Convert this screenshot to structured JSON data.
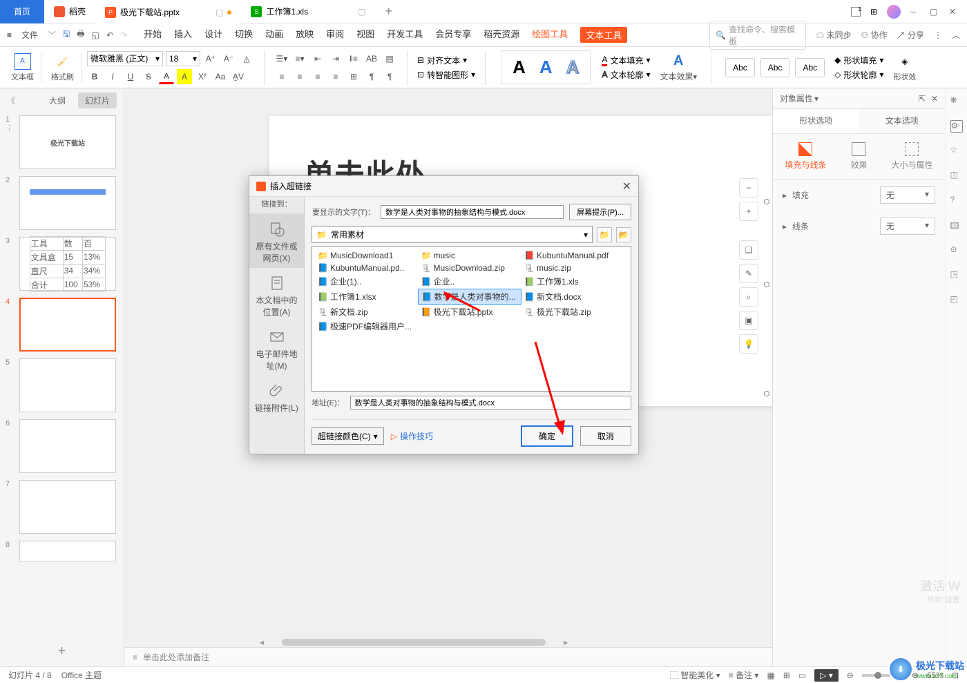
{
  "titlebar": {
    "home": "首页",
    "tab_daoke": "稻壳",
    "tab_pptx": "极光下载站.pptx",
    "tab_xls": "工作簿1.xls",
    "new_tab": "+"
  },
  "menubar": {
    "file": "文件",
    "tabs": [
      "开始",
      "插入",
      "设计",
      "切换",
      "动画",
      "放映",
      "审阅",
      "视图",
      "开发工具",
      "会员专享",
      "稻壳资源",
      "绘图工具",
      "文本工具"
    ],
    "search_placeholder": "查找命令、搜索模板",
    "unsync": "未同步",
    "coop": "协作",
    "share": "分享"
  },
  "ribbon": {
    "textbox": "文本框",
    "format_painter": "格式刷",
    "font_name": "微软雅黑 (正文)",
    "font_size": "18",
    "align_text": "对齐文本",
    "smart_graphic": "转智能图形",
    "text_fill": "文本填充",
    "text_outline": "文本轮廓",
    "text_effect": "文本效果",
    "abc": "Abc",
    "shape_fill": "形状填充",
    "shape_outline": "形状轮廓",
    "shape_effect": "形状效"
  },
  "outline": {
    "outline_tab": "大纲",
    "slides_tab": "幻灯片",
    "thumb1_text": "极光下载站"
  },
  "canvas": {
    "title_text": "单击此处",
    "notes_placeholder": "单击此处添加备注"
  },
  "props": {
    "header": "对象属性",
    "shape_options": "形状选项",
    "text_options": "文本选项",
    "fill_line": "填充与线条",
    "effect": "效果",
    "size_props": "大小与属性",
    "fill": "填充",
    "line": "线条",
    "none": "无"
  },
  "dialog": {
    "title": "插入超链接",
    "link_to": "链接到：",
    "display_text_label": "要显示的文字(T)：",
    "display_text_value": "数学是人类对事物的抽象结构与模式.docx",
    "screen_tip": "屏幕提示(P)...",
    "sidebar_existing": "原有文件或网页(X)",
    "sidebar_place": "本文档中的位置(A)",
    "sidebar_email": "电子邮件地址(M)",
    "sidebar_attach": "链接附件(L)",
    "folder": "常用素材",
    "address_label": "地址(E)：",
    "address_value": "数学是人类对事物的抽象结构与模式.docx",
    "link_color": "超链接颜色(C)",
    "tips": "操作技巧",
    "ok": "确定",
    "cancel": "取消",
    "files": [
      {
        "name": "MusicDownload1",
        "type": "folder"
      },
      {
        "name": "music",
        "type": "folder"
      },
      {
        "name": "KubuntuManual.pdf",
        "type": "pdf"
      },
      {
        "name": "KubuntuManual.pd..",
        "type": "doc"
      },
      {
        "name": "MusicDownload.zip",
        "type": "zip"
      },
      {
        "name": "music.zip",
        "type": "zip"
      },
      {
        "name": "企业(1)..",
        "type": "doc"
      },
      {
        "name": "企业..",
        "type": "doc"
      },
      {
        "name": "工作簿1.xls",
        "type": "xls"
      },
      {
        "name": "工作簿1.xlsx",
        "type": "xls"
      },
      {
        "name": "数学是人类对事物的...",
        "type": "doc",
        "selected": true
      },
      {
        "name": "新文档.docx",
        "type": "doc"
      },
      {
        "name": "新文档.zip",
        "type": "zip"
      },
      {
        "name": "极光下载站.pptx",
        "type": "ppt"
      },
      {
        "name": "极光下载站.zip",
        "type": "zip"
      },
      {
        "name": "极速PDF编辑器用户...",
        "type": "doc"
      }
    ]
  },
  "statusbar": {
    "slide_count": "幻灯片 4 / 8",
    "theme": "Office 主题",
    "beautify": "智能美化",
    "notes": "备注",
    "zoom": "65%"
  },
  "watermark": {
    "line1": "激活 W",
    "line2": "转到\"设置"
  },
  "logo": {
    "text": "极光下载站",
    "url": "www.xz7.com"
  }
}
